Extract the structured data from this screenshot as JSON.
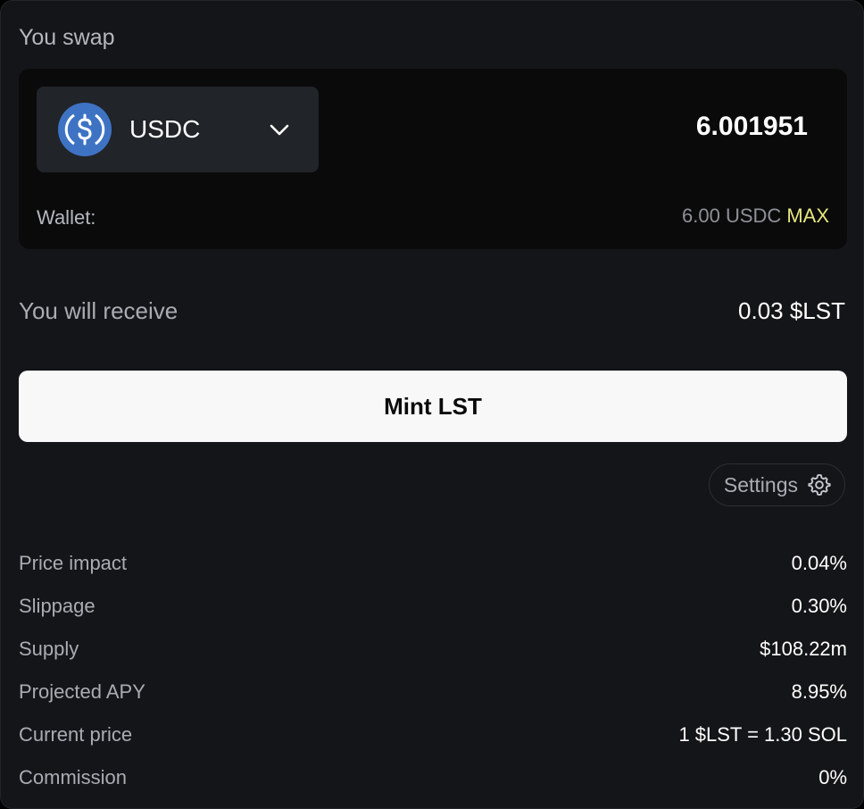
{
  "swap": {
    "title": "You swap",
    "token": {
      "symbol": "USDC",
      "icon": "usdc-icon",
      "icon_color": "#3e73c4"
    },
    "amount": "6.001951",
    "wallet_label": "Wallet:",
    "wallet_balance": "6.00 USDC",
    "max_label": "MAX"
  },
  "receive": {
    "label": "You will receive",
    "value": "0.03 $LST"
  },
  "mint_button": "Mint LST",
  "settings": {
    "label": "Settings",
    "icon": "gear-icon"
  },
  "stats": [
    {
      "label": "Price impact",
      "value": "0.04%"
    },
    {
      "label": "Slippage",
      "value": "0.30%"
    },
    {
      "label": "Supply",
      "value": "$108.22m"
    },
    {
      "label": "Projected APY",
      "value": "8.95%"
    },
    {
      "label": "Current price",
      "value": "1 $LST = 1.30 SOL"
    },
    {
      "label": "Commission",
      "value": "0%"
    }
  ],
  "colors": {
    "background": "#141518",
    "input_panel": "#0a0a0b",
    "token_select": "#212428",
    "max_accent": "#e6e680",
    "button": "#f8f8f8"
  }
}
